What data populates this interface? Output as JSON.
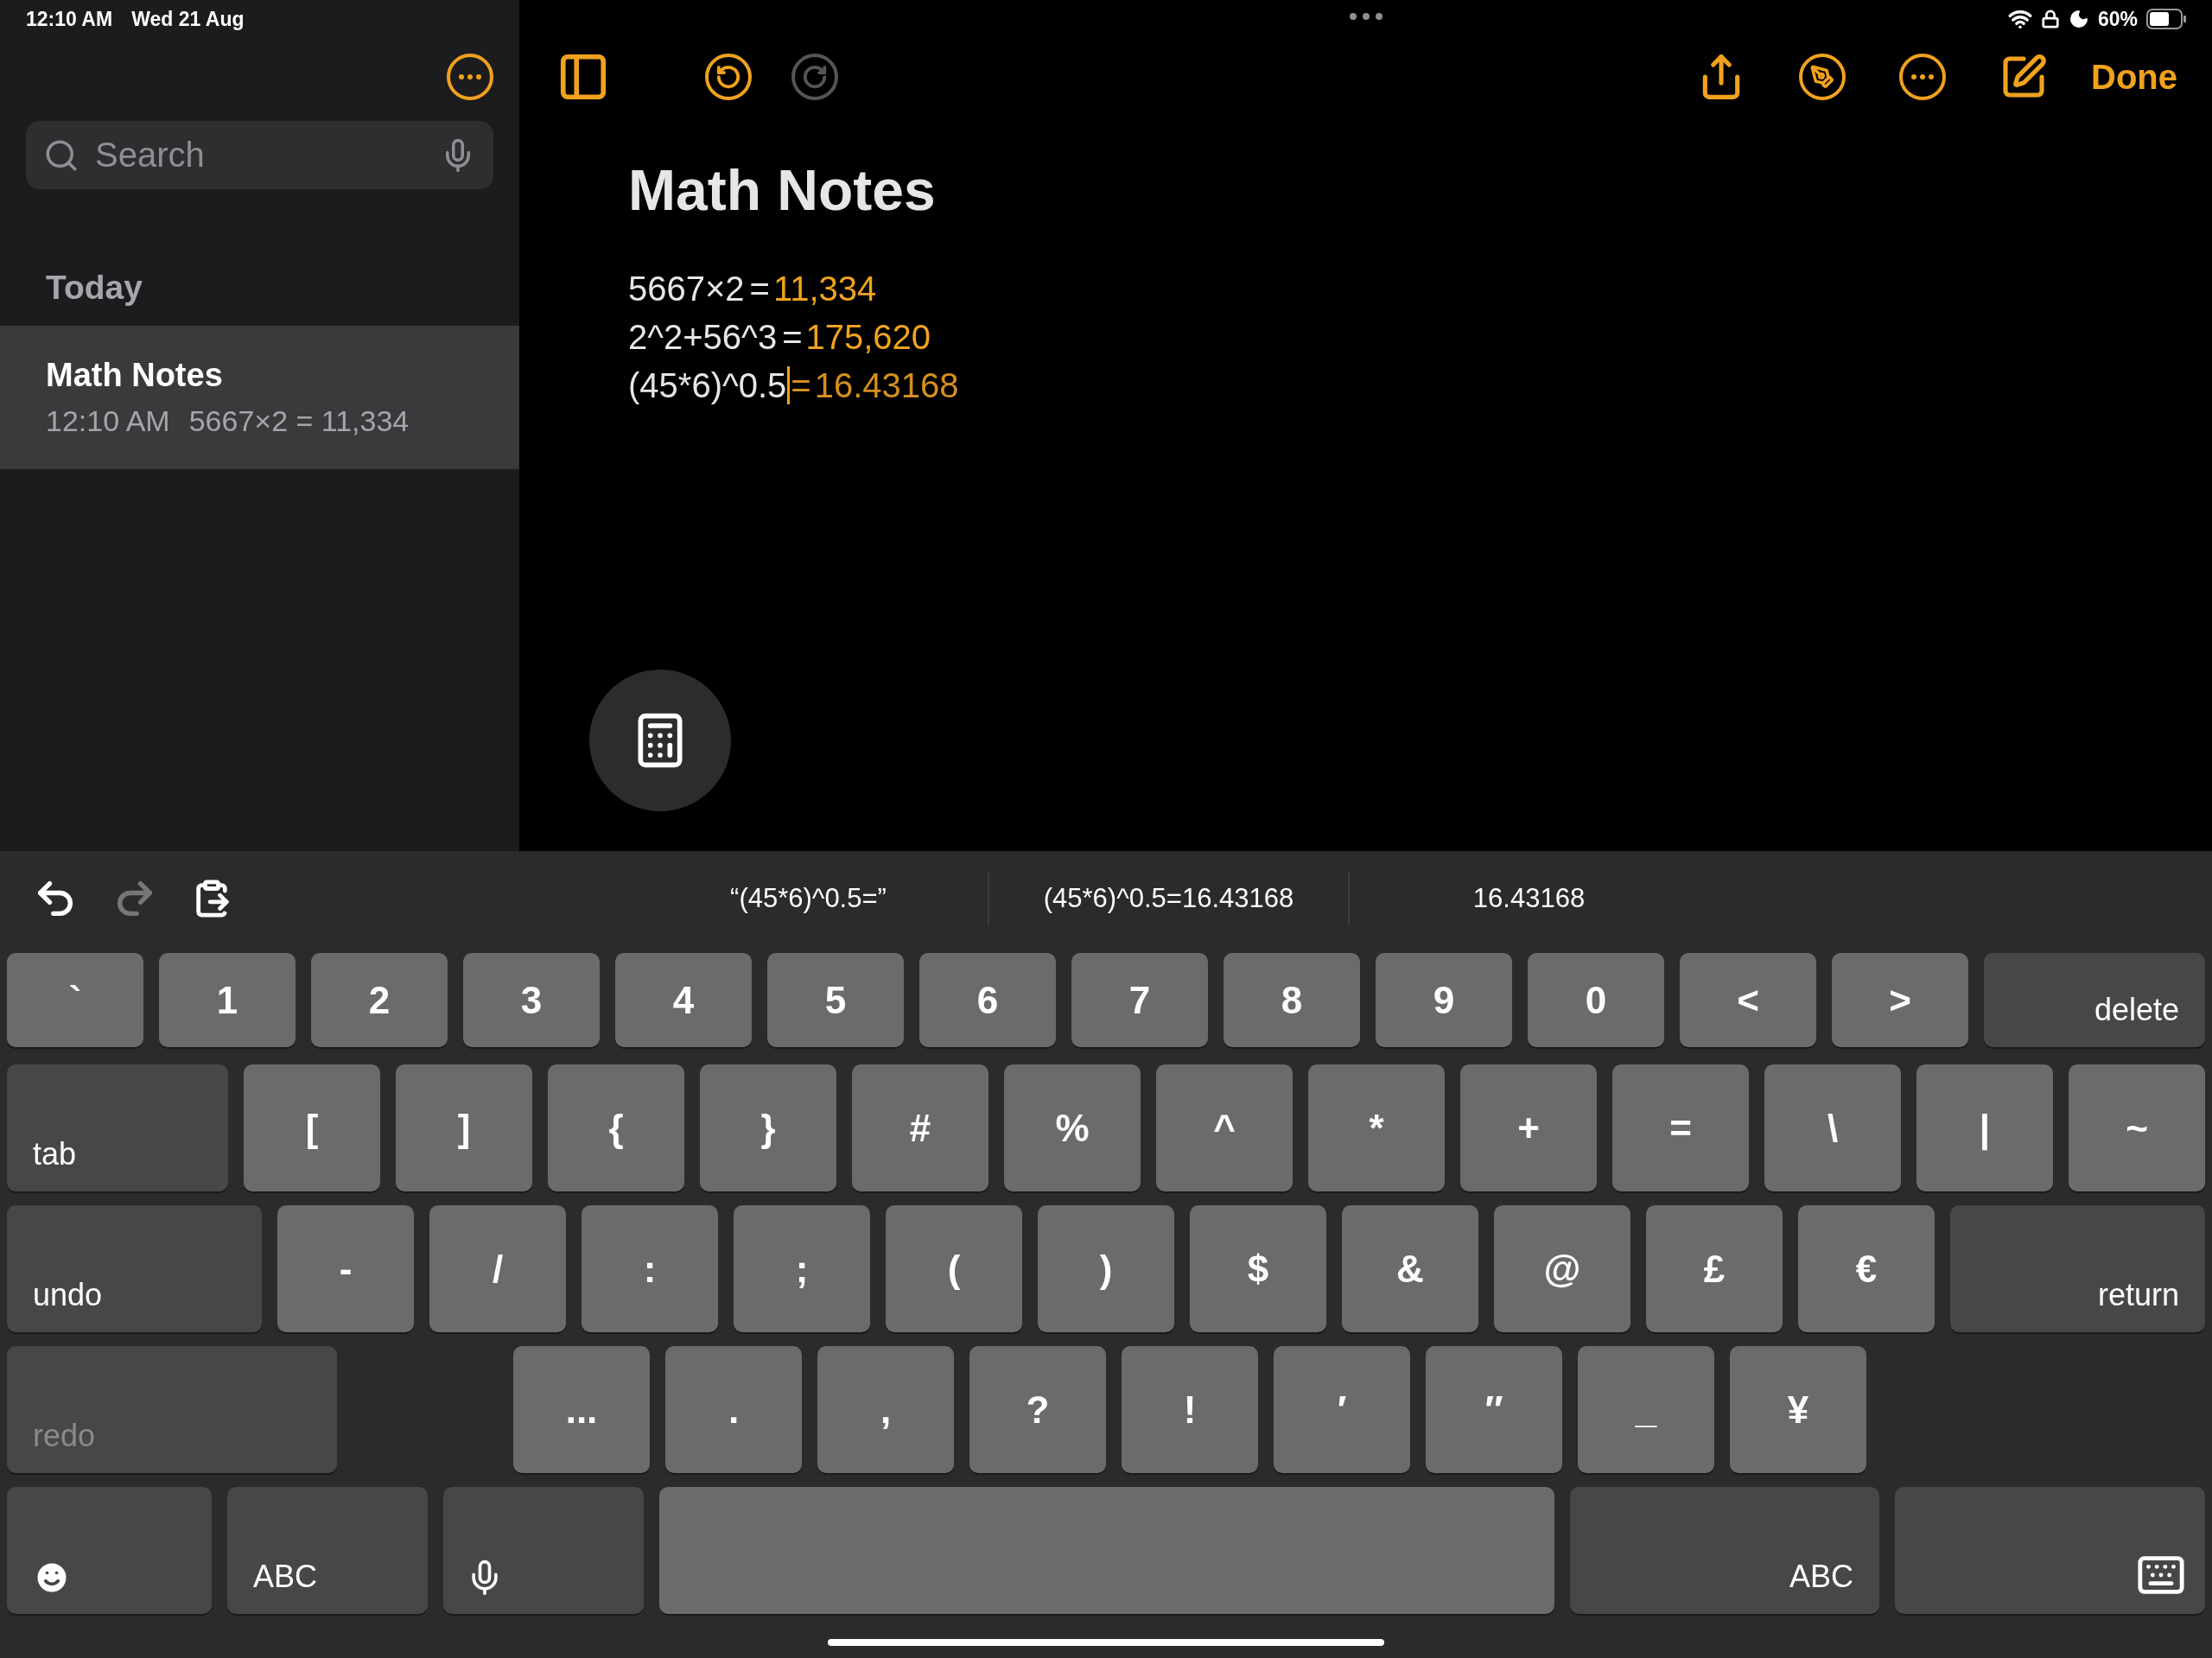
{
  "status_bar": {
    "time": "12:10 AM",
    "date": "Wed 21 Aug",
    "battery": "60%"
  },
  "sidebar": {
    "search": {
      "placeholder": "Search"
    },
    "section": "Today",
    "notes": [
      {
        "title": "Math Notes",
        "time": "12:10 AM",
        "preview": "5667×2 = 11,334",
        "selected": true
      }
    ]
  },
  "toolbar": {
    "undo_disabled": false,
    "redo_disabled": true,
    "done": "Done"
  },
  "note": {
    "title": "Math Notes",
    "lines": [
      {
        "expression": "5667×2",
        "operator": "=",
        "result": "11,334",
        "cursor": false
      },
      {
        "expression": "2^2+56^3",
        "operator": "=",
        "result": "175,620",
        "cursor": false
      },
      {
        "expression": "(45*6)^0.5",
        "operator": "=",
        "result": "16.43168",
        "cursor": true
      }
    ]
  },
  "keyboard": {
    "undo_disabled": false,
    "redo_disabled": true,
    "suggestions": [
      "“(45*6)^0.5=”",
      "(45*6)^0.5=16.43168",
      "16.43168"
    ],
    "rows": [
      {
        "keys": [
          {
            "kind": "char",
            "label": "`"
          },
          {
            "kind": "char",
            "label": "1"
          },
          {
            "kind": "char",
            "label": "2"
          },
          {
            "kind": "char",
            "label": "3"
          },
          {
            "kind": "char",
            "label": "4"
          },
          {
            "kind": "char",
            "label": "5"
          },
          {
            "kind": "char",
            "label": "6"
          },
          {
            "kind": "char",
            "label": "7"
          },
          {
            "kind": "char",
            "label": "8"
          },
          {
            "kind": "char",
            "label": "9"
          },
          {
            "kind": "char",
            "label": "0"
          },
          {
            "kind": "char",
            "label": "<"
          },
          {
            "kind": "char",
            "label": ">"
          },
          {
            "kind": "delete",
            "label": "delete"
          }
        ]
      },
      {
        "keys": [
          {
            "kind": "tab",
            "label": "tab"
          },
          {
            "kind": "char",
            "label": "["
          },
          {
            "kind": "char",
            "label": "]"
          },
          {
            "kind": "char",
            "label": "{"
          },
          {
            "kind": "char",
            "label": "}"
          },
          {
            "kind": "char",
            "label": "#"
          },
          {
            "kind": "char",
            "label": "%"
          },
          {
            "kind": "char",
            "label": "^"
          },
          {
            "kind": "char",
            "label": "*"
          },
          {
            "kind": "char",
            "label": "+"
          },
          {
            "kind": "char",
            "label": "="
          },
          {
            "kind": "char",
            "label": "\\"
          },
          {
            "kind": "char",
            "label": "|"
          },
          {
            "kind": "char",
            "label": "~"
          }
        ]
      },
      {
        "keys": [
          {
            "kind": "undo",
            "label": "undo",
            "disabled": false
          },
          {
            "kind": "char",
            "label": "-"
          },
          {
            "kind": "char",
            "label": "/"
          },
          {
            "kind": "char",
            "label": ":"
          },
          {
            "kind": "char",
            "label": ";"
          },
          {
            "kind": "char",
            "label": "("
          },
          {
            "kind": "char",
            "label": ")"
          },
          {
            "kind": "char",
            "label": "$"
          },
          {
            "kind": "char",
            "label": "&"
          },
          {
            "kind": "char",
            "label": "@"
          },
          {
            "kind": "char",
            "label": "£"
          },
          {
            "kind": "char",
            "label": "€"
          },
          {
            "kind": "return",
            "label": "return"
          }
        ]
      },
      {
        "keys": [
          {
            "kind": "redo",
            "label": "redo",
            "disabled": true
          },
          {
            "kind": "char",
            "label": "..."
          },
          {
            "kind": "char",
            "label": "."
          },
          {
            "kind": "char",
            "label": ","
          },
          {
            "kind": "char",
            "label": "?"
          },
          {
            "kind": "char",
            "label": "!"
          },
          {
            "kind": "char",
            "label": "′"
          },
          {
            "kind": "char",
            "label": "″"
          },
          {
            "kind": "char",
            "label": "_"
          },
          {
            "kind": "char",
            "label": "¥"
          }
        ]
      },
      {
        "keys": [
          {
            "kind": "emoji"
          },
          {
            "kind": "abc",
            "label": "ABC"
          },
          {
            "kind": "mic"
          },
          {
            "kind": "space"
          },
          {
            "kind": "abc-right",
            "label": "ABC"
          },
          {
            "kind": "hide"
          }
        ]
      }
    ]
  }
}
